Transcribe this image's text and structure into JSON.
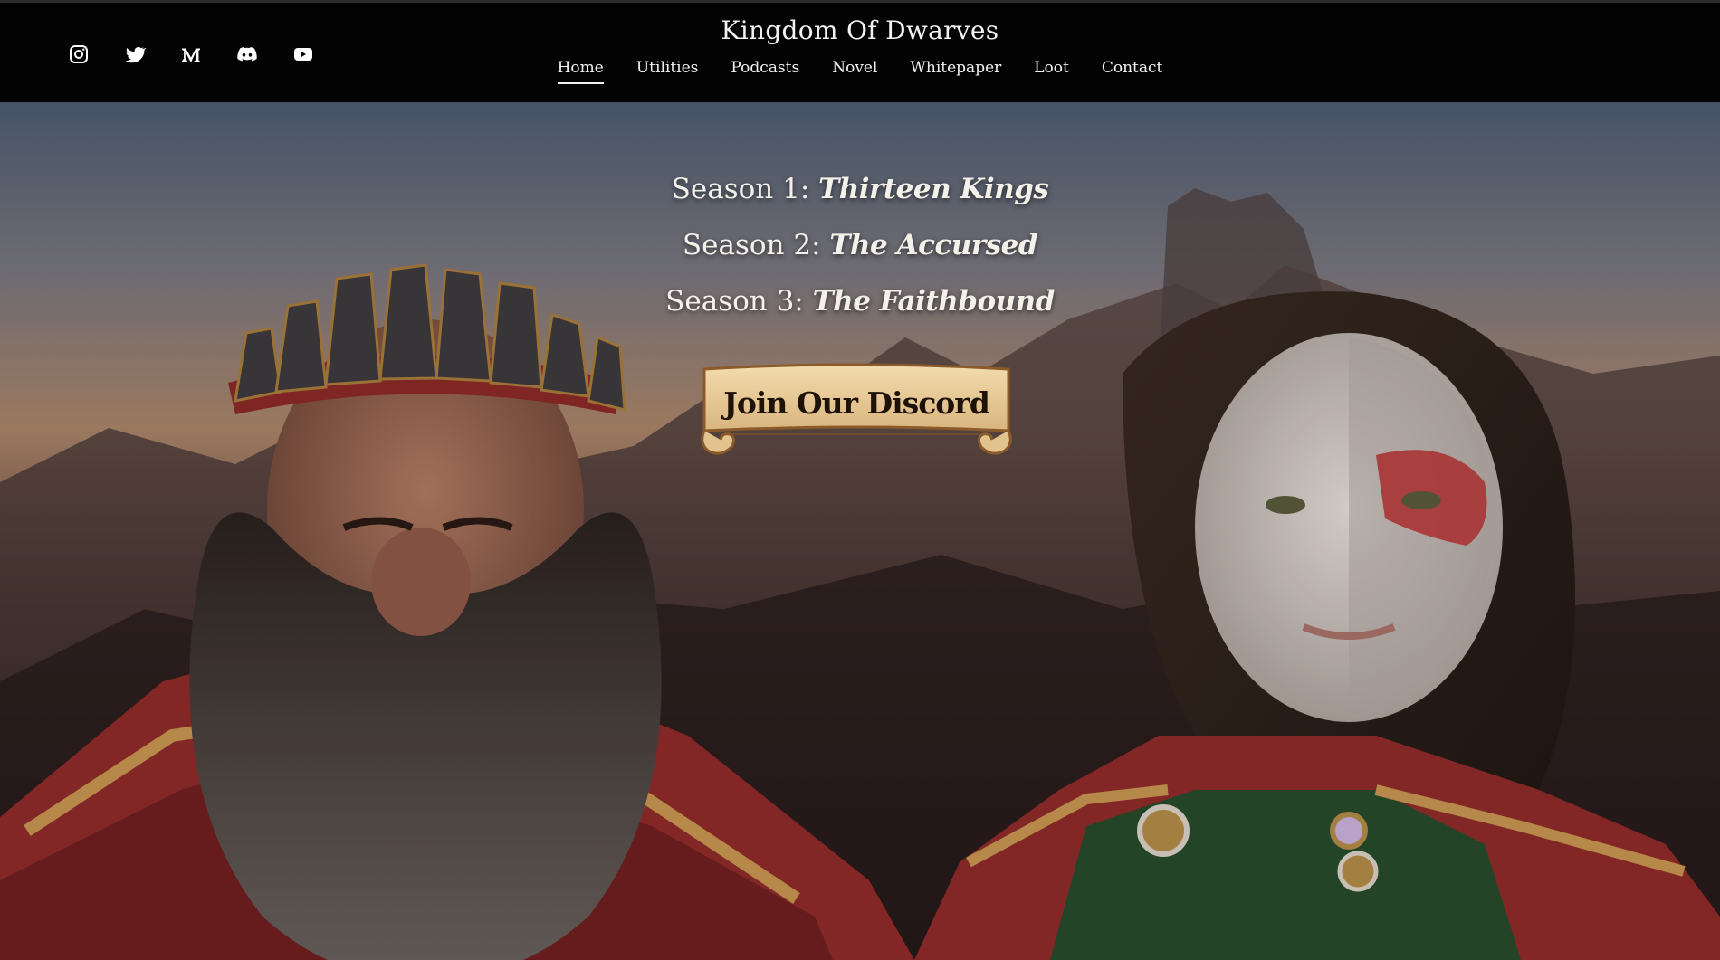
{
  "header": {
    "site_title": "Kingdom Of Dwarves",
    "socials": [
      {
        "icon": "instagram-icon"
      },
      {
        "icon": "twitter-icon"
      },
      {
        "icon": "medium-icon"
      },
      {
        "icon": "discord-icon"
      },
      {
        "icon": "youtube-icon"
      }
    ],
    "nav": [
      {
        "label": "Home",
        "active": true
      },
      {
        "label": "Utilities"
      },
      {
        "label": "Podcasts"
      },
      {
        "label": "Novel"
      },
      {
        "label": "Whitepaper"
      },
      {
        "label": "Loot"
      },
      {
        "label": "Contact"
      }
    ]
  },
  "hero": {
    "seasons": [
      {
        "prefix": "Season 1:",
        "title": "Thirteen Kings"
      },
      {
        "prefix": "Season 2:",
        "title": "The Accursed"
      },
      {
        "prefix": "Season 3:",
        "title": "The Faithbound"
      }
    ],
    "cta_label": "Join Our Discord"
  },
  "colors": {
    "header_bg": "#030303",
    "text": "#f2f2f2",
    "scroll_parchment": "#e9cfa0",
    "cloak_red": "#9b2f2c",
    "tunic_green": "#264a2a"
  }
}
